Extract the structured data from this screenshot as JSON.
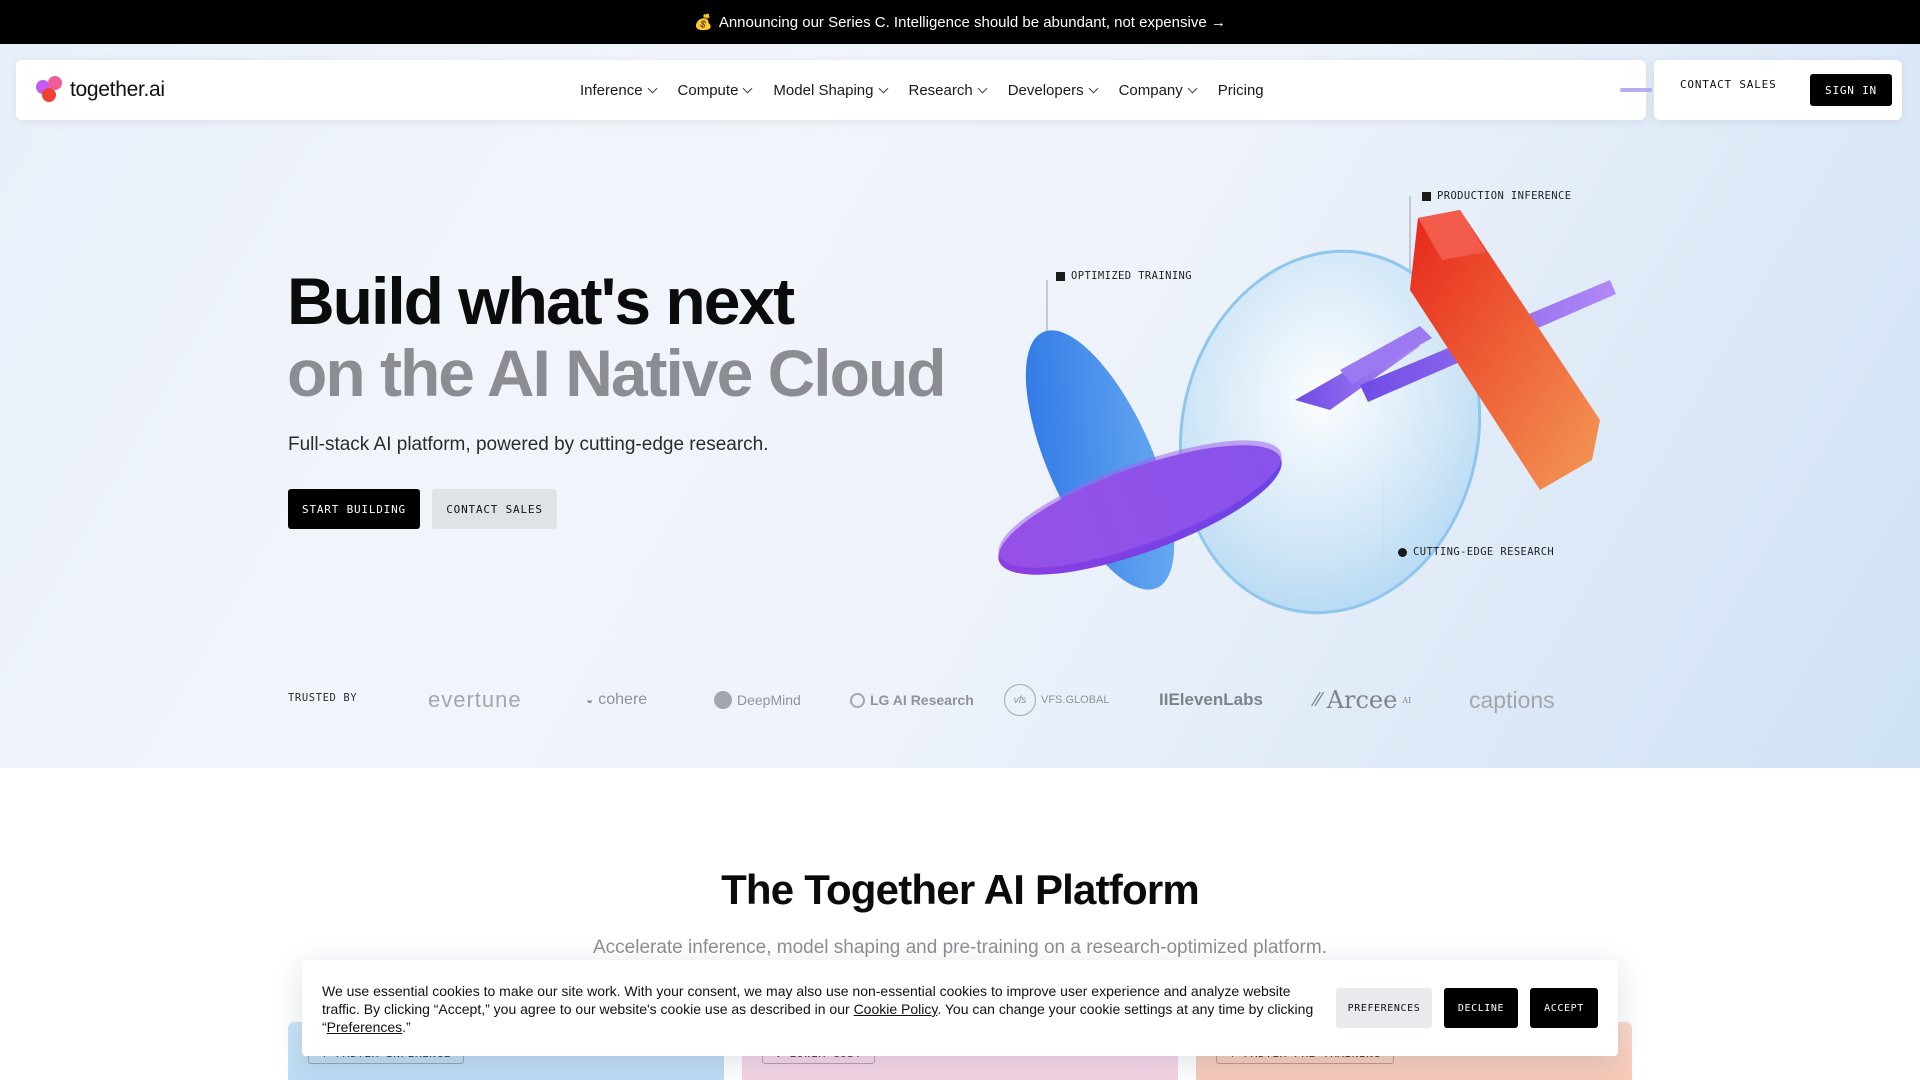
{
  "announcement": {
    "emoji": "💰",
    "text": "Announcing our Series C. Intelligence should be abundant, not expensive →"
  },
  "nav": {
    "logo_text": "together.ai",
    "items": [
      {
        "label": "Inference",
        "has_dropdown": true
      },
      {
        "label": "Compute",
        "has_dropdown": true
      },
      {
        "label": "Model Shaping",
        "has_dropdown": true
      },
      {
        "label": "Research",
        "has_dropdown": true
      },
      {
        "label": "Developers",
        "has_dropdown": true
      },
      {
        "label": "Company",
        "has_dropdown": true
      },
      {
        "label": "Pricing",
        "has_dropdown": false
      }
    ],
    "contact_sales": "CONTACT SALES",
    "sign_in": "SIGN IN"
  },
  "hero": {
    "title_line1": "Build what's next",
    "title_line2": "on the AI Native Cloud",
    "subtitle": "Full-stack AI platform, powered by cutting-edge research.",
    "cta_primary": "START BUILDING",
    "cta_secondary": "CONTACT SALES",
    "labels": {
      "production": "PRODUCTION INFERENCE",
      "training": "OPTIMIZED TRAINING",
      "research": "CUTTING-EDGE RESEARCH"
    }
  },
  "trusted": {
    "label": "TRUSTED BY",
    "logos": [
      "evertune",
      "cohere",
      "DeepMind",
      "LG AI Research",
      "VFS.GLOBAL",
      "IIElevenLabs",
      "Arcee",
      "captions"
    ],
    "arcee_sup": "AI",
    "vfs_mark": "vfs"
  },
  "platform": {
    "title": "The Together AI Platform",
    "subtitle": "Accelerate inference, model shaping and pre-training on a research-optimized platform.",
    "cards": [
      {
        "chip": "↑ FASTER INFERENCE"
      },
      {
        "chip": "↓ LOWER COST"
      },
      {
        "chip": "↑ FASTER PRE-TRAINING"
      }
    ]
  },
  "cookie": {
    "text_before": "We use essential cookies to make our site work. With your consent, we may also use non-essential cookies to improve user experience and analyze website traffic. By clicking “Accept,” you agree to our website's cookie use as described in our ",
    "policy_link": "Cookie Policy",
    "text_middle": ". You can change your cookie settings at any time by clicking “",
    "preferences_link": "Preferences",
    "text_after": ".”",
    "preferences_button": "PREFERENCES",
    "decline_button": "DECLINE",
    "accept_button": "ACCEPT"
  },
  "colors": {
    "accent_black": "#000000",
    "title_gray": "#8b8d92",
    "hero_bg": "#eaf1f9",
    "card_blue": "#bcdcf3",
    "card_pink": "#f6d6e6",
    "card_peach": "#f8cdbd"
  }
}
